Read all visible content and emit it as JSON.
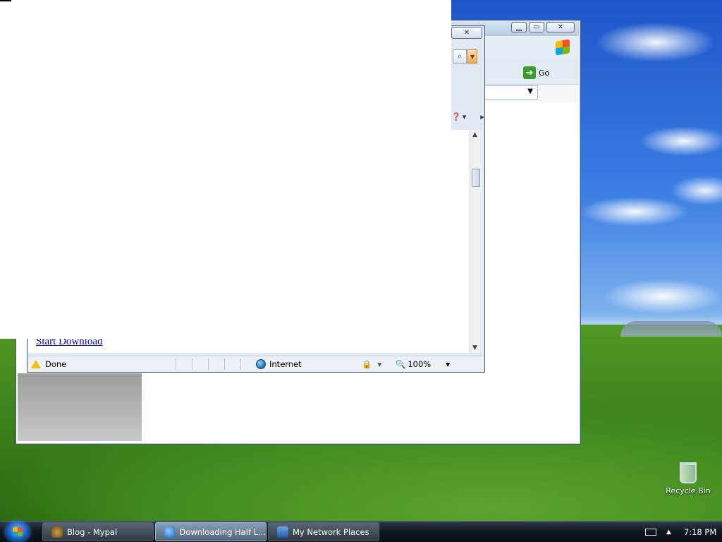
{
  "desktop": {
    "recycle_bin_label": "Recycle Bin"
  },
  "back_window": {
    "go_label": "Go",
    "colors": {
      "titlebar": "#c9d8ea",
      "frame": "#4a5b73"
    }
  },
  "front_window": {
    "link_text": "Start Download",
    "status": {
      "done": "Done",
      "zone": "Internet",
      "zoom": "100%"
    }
  },
  "taskbar": {
    "items": [
      {
        "label": "Blog - Mypal",
        "icon": "mypal-icon",
        "active": false
      },
      {
        "label": "Downloading Half L...",
        "icon": "ie-icon",
        "active": true
      },
      {
        "label": "My Network Places",
        "icon": "network-places-icon",
        "active": false
      }
    ],
    "clock": "7:18 PM"
  },
  "icons": {
    "start": "windows-start-orb",
    "search": "search-icon",
    "warning": "warning-icon",
    "globe": "globe-icon",
    "zoom": "zoom-icon",
    "recycle": "recycle-bin-icon"
  }
}
